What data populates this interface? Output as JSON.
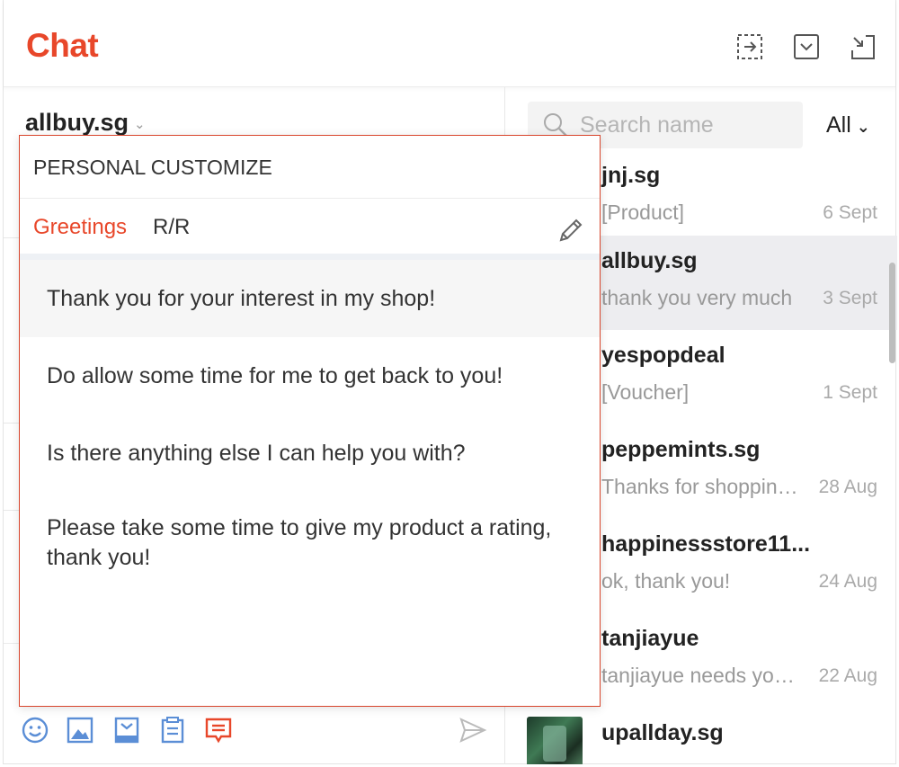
{
  "header": {
    "title": "Chat"
  },
  "chat": {
    "current_user": "allbuy.sg"
  },
  "search": {
    "placeholder": "Search name"
  },
  "filter": {
    "label": "All"
  },
  "conversations": [
    {
      "name": "jnj.sg",
      "preview": "[Product]",
      "date": "6 Sept"
    },
    {
      "name": "allbuy.sg",
      "preview": "thank you very much",
      "date": "3 Sept"
    },
    {
      "name": "yespopdeal",
      "preview": "[Voucher]",
      "date": "1 Sept"
    },
    {
      "name": "peppemints.sg",
      "preview": "Thanks for shopping with us!",
      "date": "28 Aug"
    },
    {
      "name": "happinessstore11...",
      "preview": "ok, thank you!",
      "date": "24 Aug"
    },
    {
      "name": "tanjiayue",
      "preview": "tanjiayue needs your help",
      "date": "22 Aug"
    },
    {
      "name": "upallday.sg",
      "preview": "",
      "date": ""
    }
  ],
  "popup": {
    "title": "PERSONAL CUSTOMIZE",
    "tabs": [
      "Greetings",
      "R/R"
    ],
    "replies": [
      "Thank you for your interest in my shop!",
      "Do allow some time for me to get back to you!",
      "Is there anything else I can help you with?",
      "Please take some time to give my product a rating, thank you!"
    ]
  },
  "colors": {
    "accent": "#e8472a",
    "icon_blue": "#5b8ed6",
    "active_row": "#ededf0"
  }
}
